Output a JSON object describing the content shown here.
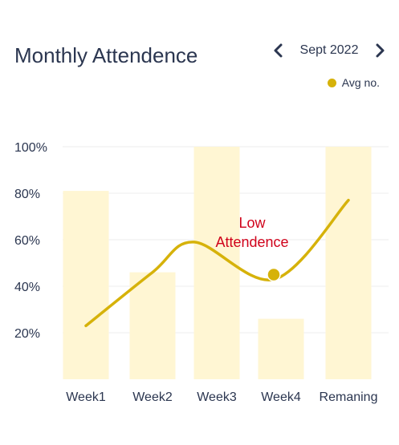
{
  "header": {
    "title": "Monthly Attendence",
    "month": "Sept 2022",
    "prev_icon": "chevron-left-icon",
    "next_icon": "chevron-right-icon"
  },
  "legend": {
    "label": "Avg no.",
    "color": "#d6b20a"
  },
  "chart_data": {
    "type": "bar",
    "categories": [
      "Week1",
      "Week2",
      "Week3",
      "Week4",
      "Remaning"
    ],
    "values": [
      81,
      46,
      100,
      26,
      100
    ],
    "ylim": [
      0,
      100
    ],
    "yticks": [
      "20%",
      "40%",
      "60%",
      "80%",
      "100%"
    ],
    "bar_color": "#fff6d3",
    "grid": true,
    "line": {
      "name": "Avg no.",
      "color": "#d6b20a",
      "values": [
        23,
        46,
        59,
        43,
        77
      ],
      "x": [
        0,
        1,
        1.65,
        2.9,
        4
      ]
    },
    "annotation": {
      "lines": [
        "Low",
        "Attendence"
      ],
      "color": "#d0021b",
      "x": 2.9,
      "y": 45
    }
  }
}
